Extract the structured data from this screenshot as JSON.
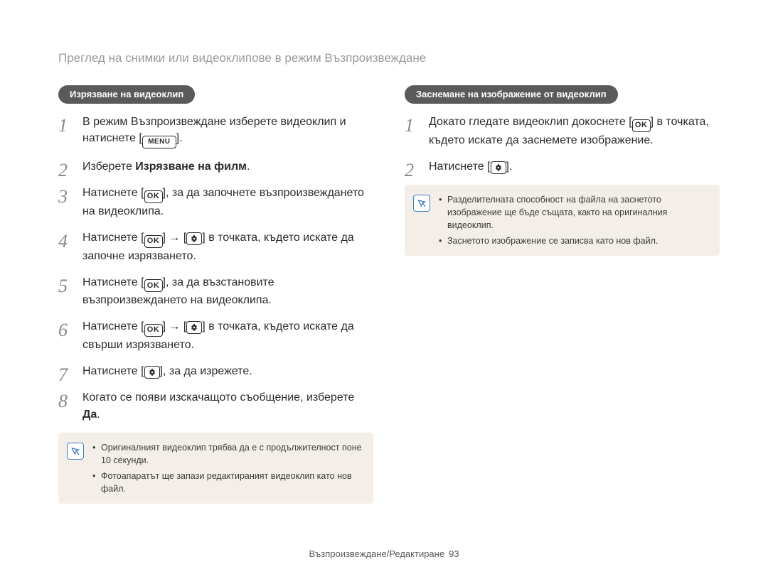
{
  "header": "Преглед на снимки или видеоклипове в режим Възпроизвеждане",
  "icons": {
    "ok": "OK",
    "menu": "MENU"
  },
  "left": {
    "title": "Изрязване на видеоклип",
    "steps": {
      "s1a": "В режим Възпроизвеждане изберете видеоклип и натиснете [",
      "s1b": "].",
      "s2a": "Изберете ",
      "s2b": "Изрязване на филм",
      "s2c": ".",
      "s3a": "Натиснете [",
      "s3b": "], за да започнете възпроизвеждането на видеоклипа.",
      "s4a": "Натиснете [",
      "s4b": "] → [",
      "s4c": "] в точката, където искате да започне изрязването.",
      "s5a": "Натиснете [",
      "s5b": "], за да възстановите възпроизвеждането на видеоклипа.",
      "s6a": "Натиснете [",
      "s6b": "] → [",
      "s6c": "] в точката, където искате да свърши изрязването.",
      "s7a": "Натиснете [",
      "s7b": "], за да изрежете.",
      "s8a": "Когато се появи изскачащото съобщение, изберете ",
      "s8b": "Да",
      "s8c": "."
    },
    "notes": [
      "Оригиналният видеоклип трябва да е с продължителност поне 10 секунди.",
      "Фотоапаратът ще запази редактираният видеоклип като нов файл."
    ]
  },
  "right": {
    "title": "Заснемане на изображение от видеоклип",
    "steps": {
      "s1a": "Докато гледате видеоклип докоснете [",
      "s1b": "] в точката, където искате да заснемете изображение.",
      "s2a": "Натиснете [",
      "s2b": "]."
    },
    "notes": [
      "Разделителната способност на файла на заснетото изображение ще бъде същата, както на оригиналния видеоклип.",
      "Заснетото изображение се записва като нов файл."
    ]
  },
  "footer": {
    "section": "Възпроизвеждане/Редактиране",
    "page": "93"
  }
}
